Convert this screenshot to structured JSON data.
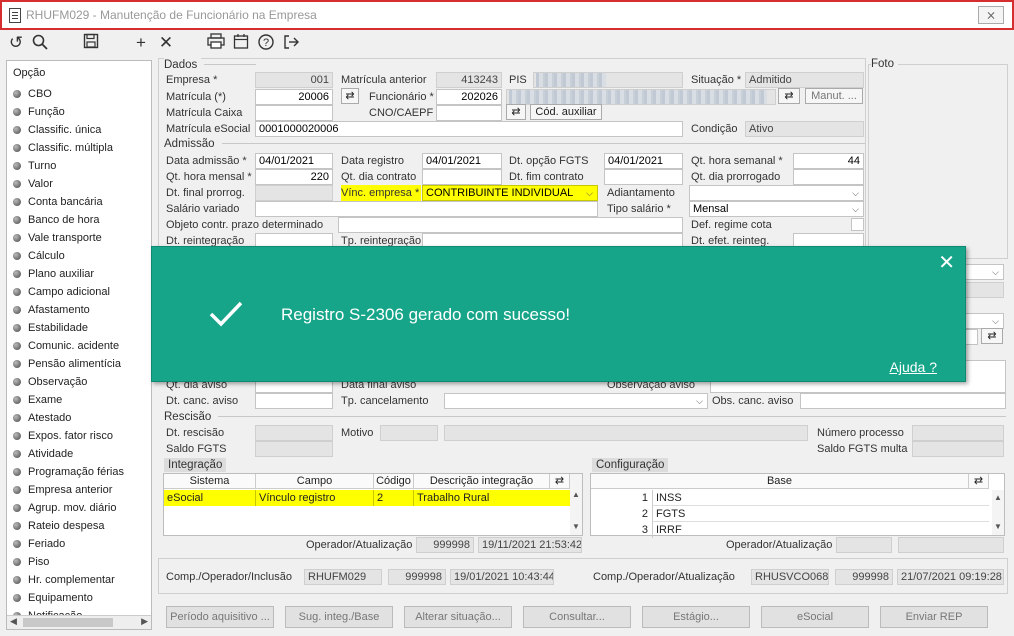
{
  "window": {
    "title": "RHUFM029 - Manutenção de Funcionário na Empresa",
    "close": "⨯"
  },
  "sidebar": {
    "header": "Opção",
    "items": [
      "CBO",
      "Função",
      "Classific. única",
      "Classific. múltipla",
      "Turno",
      "Valor",
      "Conta bancária",
      "Banco de hora",
      "Vale transporte",
      "Cálculo",
      "Plano auxiliar",
      "Campo adicional",
      "Afastamento",
      "Estabilidade",
      "Comunic. acidente",
      "Pensão alimentícia",
      "Observação",
      "Exame",
      "Atestado",
      "Expos. fator risco",
      "Atividade",
      "Programação férias",
      "Empresa anterior",
      "Agrup. mov. diário",
      "Rateio despesa",
      "Feriado",
      "Piso",
      "Hr. complementar",
      "Equipamento",
      "Notificação"
    ]
  },
  "dados": {
    "section": "Dados",
    "empresa_label": "Empresa *",
    "empresa": "001",
    "matricula_ant_label": "Matrícula anterior",
    "matricula_ant": "413243",
    "pis_label": "PIS",
    "situacao_label": "Situação *",
    "situacao": "Admitido",
    "matricula_label": "Matrícula (*)",
    "matricula": "20006",
    "funcionario_label": "Funcionário *",
    "funcionario": "202026",
    "manut_btn": "Manut. ...",
    "matricula_caixa_label": "Matrícula Caixa",
    "cno_label": "CNO/CAEPF",
    "cod_auxiliar_btn": "Cód. auxiliar",
    "matricula_esocial_label": "Matrícula eSocial",
    "matricula_esocial": "0001000020006",
    "condicao_label": "Condição",
    "condicao": "Ativo",
    "foto_label": "Foto"
  },
  "admissao": {
    "section": "Admissão",
    "dt_admissao_label": "Data admissão *",
    "dt_admissao": "04/01/2021",
    "dt_registro_label": "Data registro",
    "dt_registro": "04/01/2021",
    "dt_opcao_fgts_label": "Dt. opção FGTS",
    "dt_opcao_fgts": "04/01/2021",
    "qt_hora_semanal_label": "Qt. hora semanal *",
    "qt_hora_semanal": "44",
    "qt_hora_mensal_label": "Qt. hora mensal *",
    "qt_hora_mensal": "220",
    "qt_dia_contrato_label": "Qt. dia contrato",
    "dt_fim_contrato_label": "Dt. fim contrato",
    "qt_dia_prorrogado_label": "Qt. dia prorrogado",
    "dt_final_prorrog_label": "Dt. final prorrog.",
    "vinc_empresa_label": "Vínc. empresa *",
    "vinc_empresa": "CONTRIBUINTE INDIVIDUAL",
    "adiantamento_label": "Adiantamento",
    "salario_variado_label": "Salário variado",
    "tipo_salario_label": "Tipo salário *",
    "tipo_salario": "Mensal",
    "objeto_label": "Objeto contr. prazo determinado",
    "def_regime_label": "Def. regime cota",
    "dt_reintegracao_label": "Dt. reintegração",
    "tp_reintegracao_label": "Tp. reintegração",
    "dt_efet_reinteg_label": "Dt. efet. reinteg."
  },
  "aviso": {
    "qt_dia_aviso_label": "Qt. dia aviso",
    "data_final_aviso_label": "Data final aviso",
    "observacao_aviso_label": "Observação aviso",
    "dt_canc_aviso_label": "Dt. canc. aviso",
    "tp_cancelamento_label": "Tp. cancelamento",
    "obs_canc_aviso_label": "Obs. canc. aviso"
  },
  "rescisao": {
    "section": "Rescisão",
    "dt_rescisao_label": "Dt. rescisão",
    "motivo_label": "Motivo",
    "numero_processo_label": "Número processo",
    "saldo_fgts_label": "Saldo FGTS",
    "saldo_fgts_multa_label": "Saldo FGTS multa"
  },
  "integracao": {
    "section": "Integração",
    "columns": [
      "Sistema",
      "Campo",
      "Código",
      "Descrição integração"
    ],
    "rows": [
      {
        "sistema": "eSocial",
        "campo": "Vínculo registro",
        "codigo": "2",
        "descricao": "Trabalho Rural"
      }
    ],
    "operador_label": "Operador/Atualização",
    "operador": "999998",
    "atualizacao": "19/11/2021 21:53:42"
  },
  "configuracao": {
    "section": "Configuração",
    "column": "Base",
    "rows": [
      {
        "n": "1",
        "base": "INSS"
      },
      {
        "n": "2",
        "base": "FGTS"
      },
      {
        "n": "3",
        "base": "IRRF"
      }
    ],
    "operador_label": "Operador/Atualização"
  },
  "footer": {
    "inclusao_label": "Comp./Operador/Inclusão",
    "inclusao_comp": "RHUFM029",
    "inclusao_op": "999998",
    "inclusao_dt": "19/01/2021 10:43:44",
    "atualizacao_label": "Comp./Operador/Atualização",
    "atualizacao_comp": "RHUSVCO068",
    "atualizacao_op": "999998",
    "atualizacao_dt": "21/07/2021 09:19:28"
  },
  "buttons": [
    "Período aquisitivo ...",
    "Sug. integ./Base",
    "Alterar situação...",
    "Consultar...",
    "Estágio...",
    "eSocial",
    "Enviar REP"
  ],
  "toast": {
    "message": "Registro S-2306 gerado com sucesso!",
    "help": "Ajuda ?",
    "close": "✕"
  },
  "colors": {
    "toast_bg": "#16a589",
    "highlight": "#ffff00",
    "title_border": "#d42e2e"
  }
}
